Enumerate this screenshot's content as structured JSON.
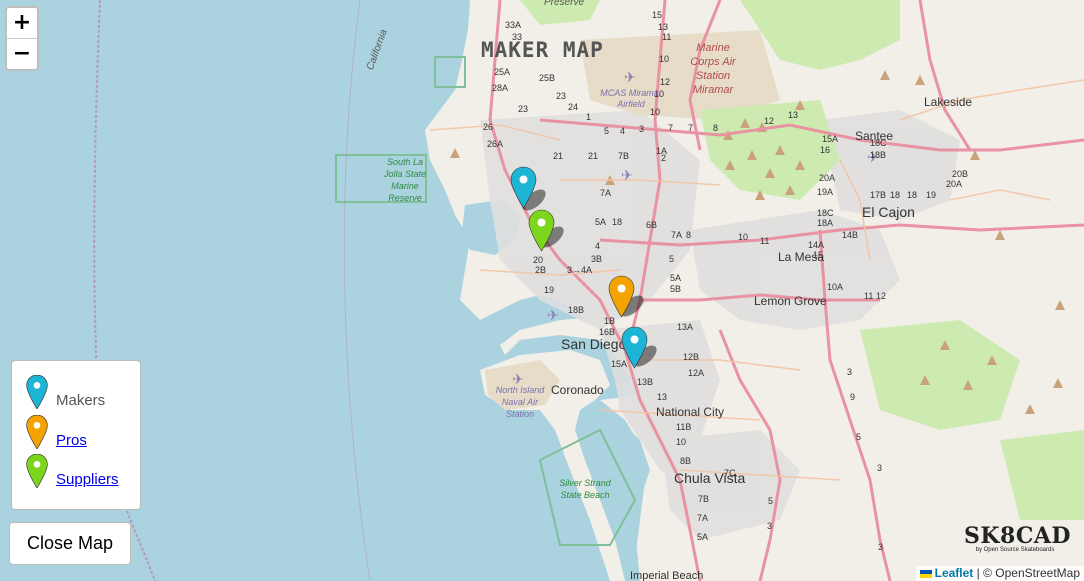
{
  "map_title": "MAKER MAP",
  "zoom": {
    "in_label": "+",
    "out_label": "−"
  },
  "legend": [
    {
      "label": "Makers",
      "color": "#1db5d6",
      "link": false
    },
    {
      "label": "Pros",
      "color": "#f5a300",
      "link": true
    },
    {
      "label": "Suppliers",
      "color": "#7cd61d",
      "link": true
    }
  ],
  "close_button": "Close Map",
  "logo": {
    "name": "SK8CAD",
    "tagline": "by Open Source Skateboards"
  },
  "attribution": {
    "leaflet": "Leaflet",
    "separator": " | © ",
    "osm": "OpenStreetMap"
  },
  "place_labels": {
    "san_diego": "San Diego",
    "coronado": "Coronado",
    "national_city": "National City",
    "chula_vista": "Chula Vista",
    "el_cajon": "El Cajon",
    "la_mesa": "La Mesa",
    "lemon_grove": "Lemon Grove",
    "santee": "Santee",
    "lakeside": "Lakeside",
    "imperial_beach": "Imperial Beach",
    "california": "California",
    "preserve": "Preserve",
    "marine_line1": "Marine",
    "marine_line2": "Corps Air",
    "marine_line3": "Station",
    "marine_line4": "Miramar",
    "mcas_line1": "MCAS Miramar",
    "mcas_line2": "Airfield",
    "reserve_line1": "South La",
    "reserve_line2": "Jolla State",
    "reserve_line3": "Marine",
    "reserve_line4": "Reserve",
    "ni_line1": "North Island",
    "ni_line2": "Naval Air",
    "ni_line3": "Station",
    "ss_line1": "Silver Strand",
    "ss_line2": "State Beach"
  },
  "markers": [
    {
      "type": "Makers",
      "color": "#1db5d6"
    },
    {
      "type": "Suppliers",
      "color": "#7cd61d"
    },
    {
      "type": "Pros",
      "color": "#f5a300"
    },
    {
      "type": "Makers",
      "color": "#1db5d6"
    }
  ]
}
